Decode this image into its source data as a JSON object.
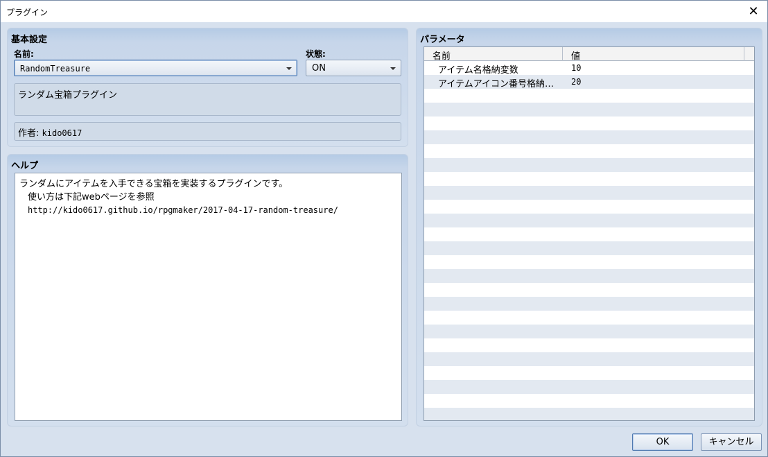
{
  "window": {
    "title": "プラグイン",
    "close_glyph": "✕"
  },
  "basic": {
    "title": "基本設定",
    "name_label": "名前:",
    "name_value": "RandomTreasure",
    "status_label": "状態:",
    "status_value": "ON",
    "description": "ランダム宝箱プラグイン",
    "author_label": "作者:",
    "author_value": "kido0617"
  },
  "help": {
    "title": "ヘルプ",
    "lines": [
      "ランダムにアイテムを入手できる宝箱を実装するプラグインです。",
      "使い方は下記webページを参照",
      "http://kido0617.github.io/rpgmaker/2017-04-17-random-treasure/"
    ]
  },
  "params": {
    "title": "パラメータ",
    "col_name": "名前",
    "col_value": "値",
    "rows": [
      {
        "name": "アイテム名格納変数",
        "value": "10"
      },
      {
        "name": "アイテムアイコン番号格納…",
        "value": "20"
      }
    ]
  },
  "buttons": {
    "ok": "OK",
    "cancel": "キャンセル"
  },
  "icons": {
    "close": "close-icon",
    "dropdown": "chevron-down-icon"
  }
}
